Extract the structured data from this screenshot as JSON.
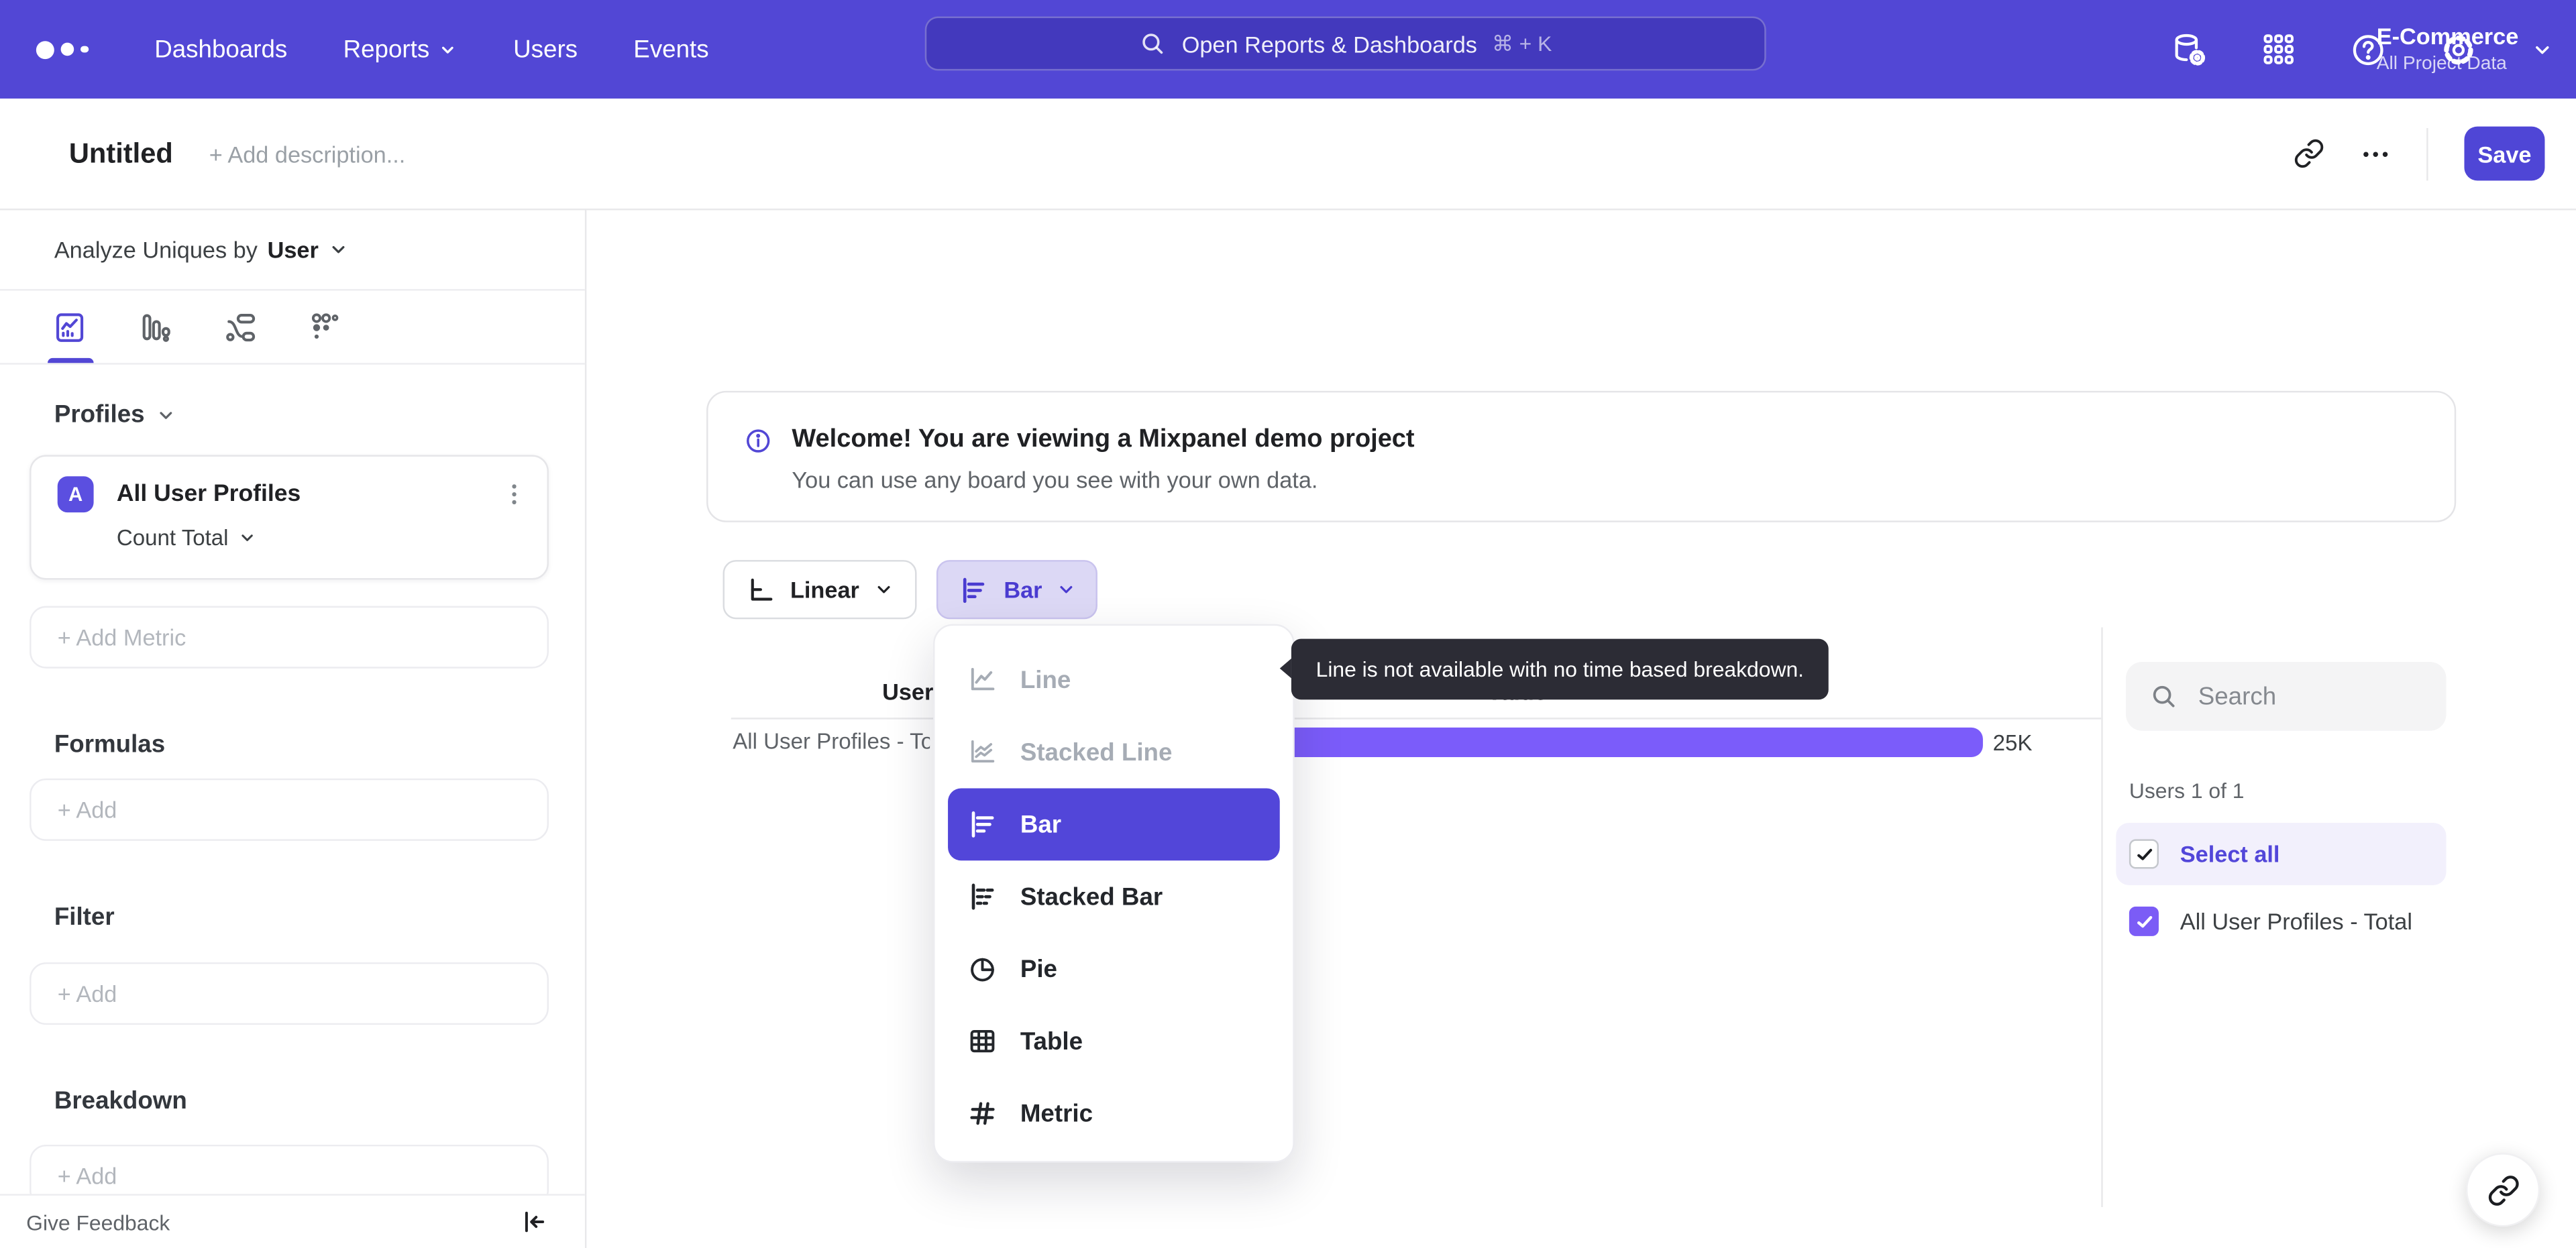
{
  "topbar": {
    "nav": [
      {
        "label": "Dashboards"
      },
      {
        "label": "Reports",
        "has_chevron": true
      },
      {
        "label": "Users"
      },
      {
        "label": "Events"
      }
    ],
    "search": {
      "placeholder": "Open Reports & Dashboards",
      "shortcut": "⌘ + K"
    },
    "project": {
      "name": "E-Commerce",
      "scope": "All Project Data"
    }
  },
  "header": {
    "title": "Untitled",
    "description_placeholder": "+ Add description...",
    "save_label": "Save"
  },
  "sidebar": {
    "analyze": {
      "prefix": "Analyze Uniques by",
      "value": "User"
    },
    "profiles": {
      "title": "Profiles",
      "metric": {
        "badge": "A",
        "name": "All User Profiles",
        "aggregation": "Count Total"
      },
      "add_metric_label": "+  Add Metric"
    },
    "sections": [
      {
        "title": "Formulas",
        "add_label": "+  Add"
      },
      {
        "title": "Filter",
        "add_label": "+  Add"
      },
      {
        "title": "Breakdown",
        "add_label": "+  Add"
      }
    ],
    "footer": {
      "feedback_label": "Give Feedback"
    }
  },
  "main": {
    "banner": {
      "title": "Welcome! You are viewing a Mixpanel demo project",
      "subtitle": "You can use any board you see with your own data."
    },
    "controls": {
      "time_interval": {
        "label": "Linear"
      },
      "chart_type": {
        "label": "Bar"
      }
    },
    "dropdown": {
      "items": [
        {
          "label": "Line",
          "state": "disabled"
        },
        {
          "label": "Stacked Line",
          "state": "disabled"
        },
        {
          "label": "Bar",
          "state": "selected"
        },
        {
          "label": "Stacked Bar",
          "state": "normal"
        },
        {
          "label": "Pie",
          "state": "normal"
        },
        {
          "label": "Table",
          "state": "normal"
        },
        {
          "label": "Metric",
          "state": "normal"
        }
      ]
    },
    "tooltip": {
      "text": "Line is not available with no time based breakdown."
    }
  },
  "chart_data": {
    "type": "bar",
    "orientation": "horizontal",
    "columns": [
      "Users",
      "Value"
    ],
    "categories": [
      "All User Profiles - Total"
    ],
    "values": [
      25000
    ],
    "value_labels": [
      "25K"
    ],
    "bar_color": "#7b5cfa",
    "grid": false,
    "xlim": [
      0,
      25000
    ]
  },
  "right_panel": {
    "search_placeholder": "Search",
    "count_label": "Users 1 of 1",
    "select_all_label": "Select all",
    "items": [
      {
        "label": "All User Profiles - Total",
        "checked": true
      }
    ]
  },
  "colors": {
    "accent": "#5247d5",
    "bar_fill": "#7b5cfa",
    "selected_item_bg": "#5246d9",
    "chip_bg": "#dcd8f5",
    "tooltip_bg": "#2c2c35"
  }
}
